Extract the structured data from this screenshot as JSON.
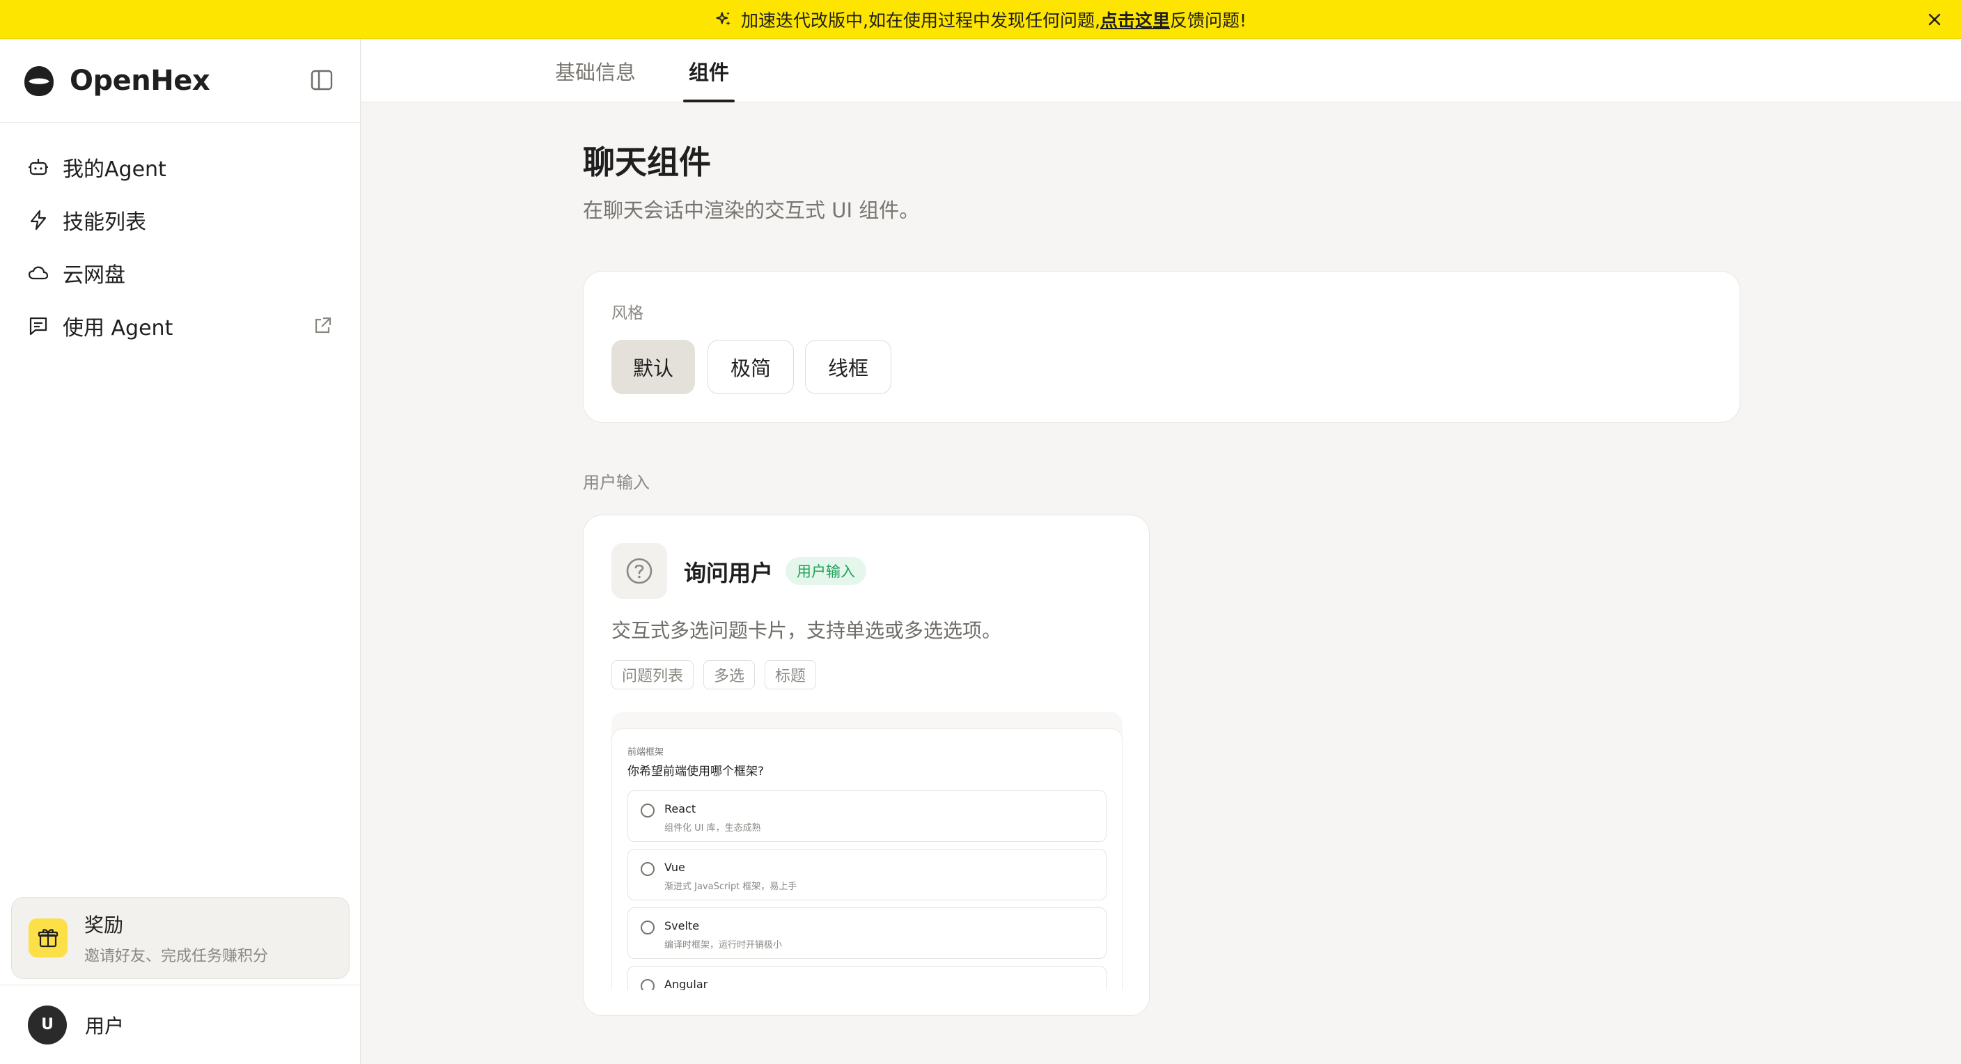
{
  "banner": {
    "text_before": "加速迭代改版中,如在使用过程中发现任何问题,",
    "link": "点击这里",
    "text_after": "反馈问题!"
  },
  "brand": {
    "name": "OpenHex"
  },
  "sidebar": {
    "items": [
      {
        "label": "我的Agent",
        "icon": "robot-icon"
      },
      {
        "label": "技能列表",
        "icon": "lightning-icon"
      },
      {
        "label": "云网盘",
        "icon": "cloud-icon"
      },
      {
        "label": "使用 Agent",
        "icon": "chat-icon"
      }
    ]
  },
  "reward": {
    "title": "奖励",
    "subtitle": "邀请好友、完成任务赚积分"
  },
  "user": {
    "avatar": "U",
    "name": "用户"
  },
  "tabs": [
    {
      "label": "基础信息",
      "active": false
    },
    {
      "label": "组件",
      "active": true
    }
  ],
  "page": {
    "title": "聊天组件",
    "subtitle": "在聊天会话中渲染的交互式 UI 组件。"
  },
  "style": {
    "label": "风格",
    "options": [
      "默认",
      "极简",
      "线框"
    ],
    "selected": "默认"
  },
  "section": {
    "label": "用户输入"
  },
  "component": {
    "title": "询问用户",
    "badge": "用户输入",
    "description": "交互式多选问题卡片，支持单选或多选选项。",
    "tags": [
      "问题列表",
      "多选",
      "标题"
    ],
    "preview": {
      "category": "前端框架",
      "question": "你希望前端使用哪个框架?",
      "options": [
        {
          "label": "React",
          "desc": "组件化 UI 库，生态成熟"
        },
        {
          "label": "Vue",
          "desc": "渐进式 JavaScript 框架，易上手"
        },
        {
          "label": "Svelte",
          "desc": "编译时框架，运行时开销极小"
        },
        {
          "label": "Angular",
          "desc": ""
        }
      ]
    }
  },
  "colors": {
    "banner": "#fde500",
    "accent_green": "#22a35a",
    "gift": "#fde047"
  }
}
